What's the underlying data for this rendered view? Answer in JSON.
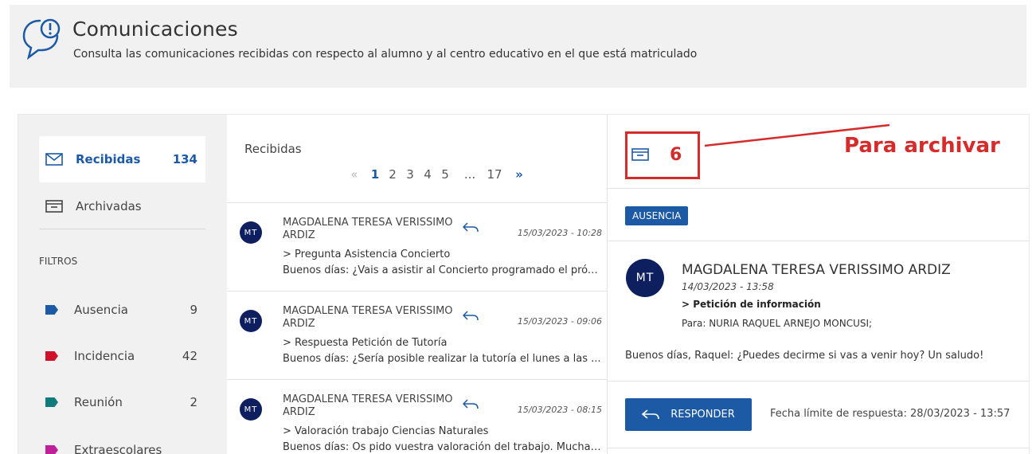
{
  "header": {
    "title": "Comunicaciones",
    "subtitle": "Consulta las comunicaciones recibidas con respecto al alumno y al centro educativo en el que está matriculado"
  },
  "sidebar": {
    "folders": [
      {
        "label": "Recibidas",
        "count": "134",
        "icon": "envelope-icon",
        "active": true
      },
      {
        "label": "Archivadas",
        "count": "",
        "icon": "archive-icon",
        "active": false
      }
    ],
    "filters_title": "FILTROS",
    "filters": [
      {
        "label": "Ausencia",
        "count": "9",
        "color": "#1c5aa6"
      },
      {
        "label": "Incidencia",
        "count": "42",
        "color": "#d0112b"
      },
      {
        "label": "Reunión",
        "count": "2",
        "color": "#117a7a"
      },
      {
        "label": "Extraescolares",
        "count": "",
        "color": "#c01f9a"
      }
    ]
  },
  "list": {
    "title": "Recibidas",
    "pagination": {
      "prev": "«",
      "pages": [
        "1",
        "2",
        "3",
        "4",
        "5"
      ],
      "current": "1",
      "ellipsis": "...",
      "last": "17",
      "next": "»"
    },
    "messages": [
      {
        "initials": "MT",
        "from": "MAGDALENA TERESA VERISSIMO ARDIZ",
        "date": "15/03/2023 - 10:28",
        "subject": "> Pregunta Asistencia Concierto",
        "preview": "Buenos días: ¿Vais a asistir al Concierto programado el próxi..."
      },
      {
        "initials": "MT",
        "from": "MAGDALENA TERESA VERISSIMO ARDIZ",
        "date": "15/03/2023 - 09:06",
        "subject": "> Respuesta Petición de Tutoría",
        "preview": "Buenos días: ¿Sería posible realizar la tutoría el lunes a las ..."
      },
      {
        "initials": "MT",
        "from": "MAGDALENA TERESA VERISSIMO ARDIZ",
        "date": "15/03/2023 - 08:15",
        "subject": "> Valoración trabajo Ciencias Naturales",
        "preview": "Buenos días: Os pido vuestra valoración del trabajo. Muchas..."
      }
    ]
  },
  "detail": {
    "annotation_number": "6",
    "annotation_text": "Para archivar",
    "tag": "AUSENCIA",
    "initials": "MT",
    "from": "MAGDALENA TERESA VERISSIMO ARDIZ",
    "date": "14/03/2023 - 13:58",
    "subject": "> Petición de información",
    "to": "Para: NURIA RAQUEL ARNEJO MONCUSI;",
    "body": "Buenos días, Raquel: ¿Puedes decirme si vas a venir hoy? Un saludo!",
    "reply_button": "RESPONDER",
    "deadline": "Fecha límite de respuesta: 28/03/2023 - 13:57"
  },
  "colors": {
    "primary": "#1c5aa6",
    "annotation": "#d62b2b",
    "avatar": "#0d1f5e"
  }
}
